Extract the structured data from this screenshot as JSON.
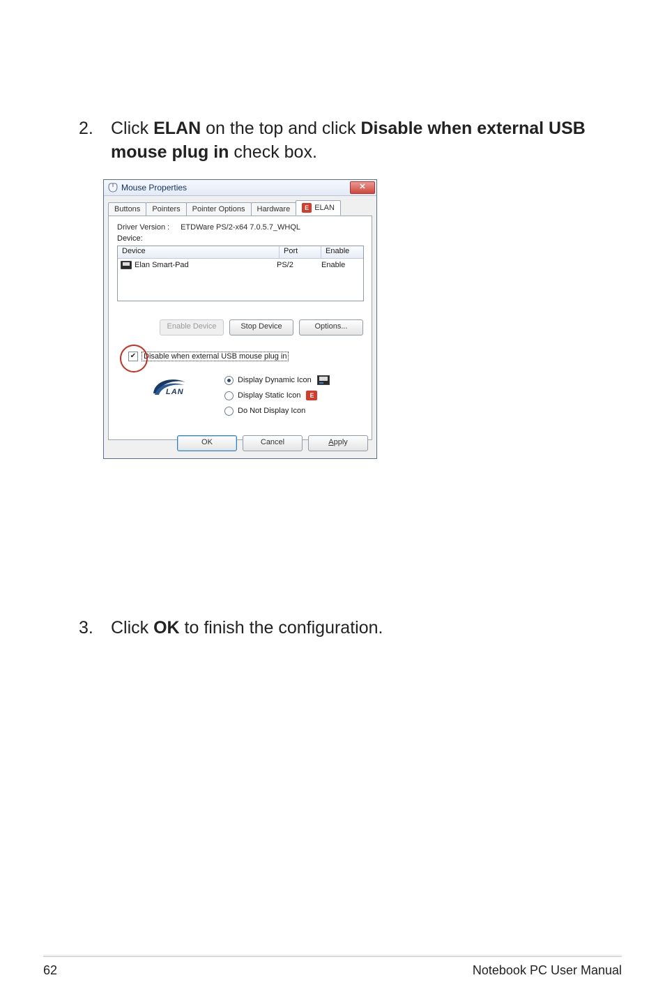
{
  "steps": {
    "s2": {
      "num": "2.",
      "pre": "Click ",
      "bold1": "ELAN",
      "mid1": " on the top and click ",
      "bold2": "Disable when external USB mouse plug in",
      "post": " check box."
    },
    "s3": {
      "num": "3.",
      "pre": "Click ",
      "bold1": "OK",
      "post": " to finish the configuration."
    }
  },
  "dialog": {
    "title": "Mouse Properties",
    "close_glyph": "✕",
    "tabs": {
      "buttons": "Buttons",
      "pointers": "Pointers",
      "pointer_options": "Pointer Options",
      "hardware": "Hardware",
      "elan": "ELAN"
    },
    "driver_label": "Driver Version :",
    "driver_value": "ETDWare PS/2-x64 7.0.5.7_WHQL",
    "device_label": "Device:",
    "table": {
      "headers": {
        "device": "Device",
        "port": "Port",
        "enable": "Enable"
      },
      "row": {
        "device": "Elan Smart-Pad",
        "port": "PS/2",
        "enable": "Enable"
      }
    },
    "buttons": {
      "enable_device": "Enable Device",
      "stop_device": "Stop Device",
      "options": "Options..."
    },
    "checkbox_label": "Disable when external USB mouse plug in",
    "radios": {
      "dynamic": "Display Dynamic Icon",
      "static": "Display Static Icon",
      "none": "Do Not Display Icon"
    },
    "logo_text": "LAN",
    "static_icon_glyph": "E",
    "footer": {
      "ok": "OK",
      "cancel": "Cancel",
      "apply": "Apply"
    }
  },
  "page_footer": {
    "page_num": "62",
    "manual": "Notebook PC User Manual"
  }
}
